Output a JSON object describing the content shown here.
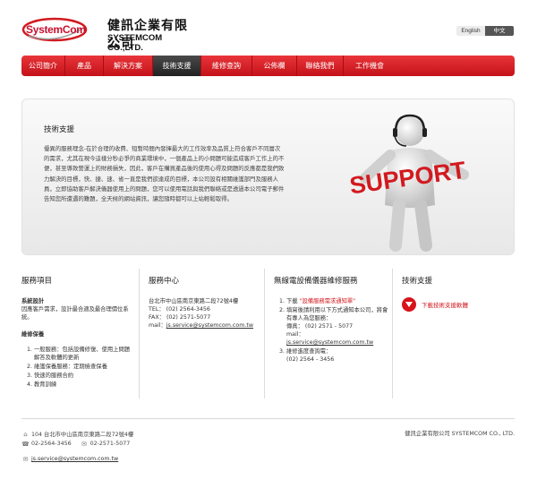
{
  "header": {
    "logo_brand": "SystemCom",
    "logo_zh": "健訊企業有限公司",
    "logo_en": "SYSTEMCOM CO.,LTD.",
    "lang_en": "English",
    "lang_zh": "中文"
  },
  "nav": {
    "items": [
      {
        "label": "公司簡介"
      },
      {
        "label": "產品"
      },
      {
        "label": "解決方案"
      },
      {
        "label": "技術支援"
      },
      {
        "label": "維修查詢"
      },
      {
        "label": "公佈欄"
      },
      {
        "label": "聯絡我們"
      },
      {
        "label": "工作機會"
      }
    ],
    "active_index": 3
  },
  "banner": {
    "title": "技術支援",
    "text": "優異的服務理念-在於合理的收費、短暫時間內發揮最大的工作效率及品質上符合客戶不同層次的需求，尤其在現今這樣分秒必爭的商業環境中，一個產品上的小問題可能造成客戶工作上的不便，甚至導致營運上的財務損失，因此，客戶在購買產品後的使用心得及問題的反應都是我們致力解決的目標，快、捷、速、省一直是我們欲達成的目標，本公司設有相關維護部門及服務人員，立即協助客戶解決儀器使用上的問題，您可以使用電話與我們聯絡或是透過本公司電子郵件告知您所遭遇的難題，全天候的網站資訊，讓您隨時都可以上站輕鬆取得。",
    "graphic_word": "SUPPORT"
  },
  "columns": {
    "service_items": {
      "title": "服務項目",
      "system_heading": "系統設計",
      "system_text": "因應客戶需求，設計最合適及最合理價位系統。",
      "repair_heading": "維修保養",
      "list": [
        "一般服務：包括設備修復、使用上問題解答及軟體的更新",
        "維護保養服務：定期檢查保養",
        "快速的服務合約",
        "教育訓練"
      ]
    },
    "service_center": {
      "title": "服務中心",
      "address": "台北市中山區南京東路二段72號4樓",
      "tel": "TEL： (02) 2564-3456",
      "fax": "FAX： (02) 2571-5077",
      "mail_label": "mail：",
      "mail": "js.service@systemcom.com.tw"
    },
    "wireless_repair": {
      "title": "無線電設備儀器維修服務",
      "step1_prefix": "下載",
      "step1_link": "\"設備服務需求通知單\"",
      "step2": "填寫後請利用以下方式通知本公司，將會有專人為您服務：",
      "fax": "傳真： (02) 2571 - 5077",
      "mail_label": "mail：",
      "mail": "js.service@systemcom.com.tw",
      "step3": "維修進度查詢電：",
      "phone": "(02) 2564 - 3456"
    },
    "tech_support": {
      "title": "技術支援",
      "download": "下載技術支援軟體"
    }
  },
  "footer": {
    "address": "104 台北市中山區南京東路二段72號4樓",
    "phone": "02-2564-3456",
    "fax": "02-2571-5077",
    "email": "js.service@systemcom.com.tw",
    "copyright": "健訊企業有限公司 SYSTEMCOM CO., LTD."
  },
  "colors": {
    "brand_red": "#d21a1f",
    "nav_active": "#333333"
  },
  "icons": [
    "location-icon",
    "phone-icon",
    "fax-icon",
    "email-icon",
    "download-icon"
  ]
}
